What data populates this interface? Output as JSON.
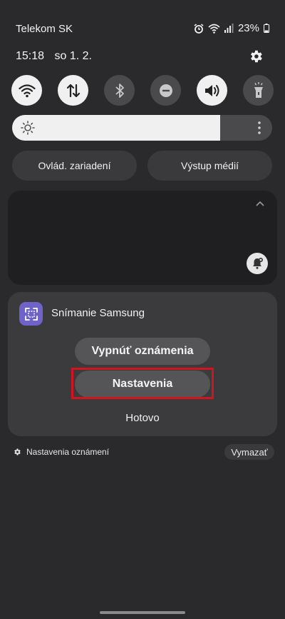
{
  "status": {
    "carrier": "Telekom SK",
    "battery": "23%"
  },
  "header": {
    "time": "15:18",
    "date": "so 1. 2."
  },
  "quick_settings": [
    {
      "icon": "wifi-icon",
      "state": "on"
    },
    {
      "icon": "mobile-data-icon",
      "state": "on"
    },
    {
      "icon": "bluetooth-icon",
      "state": "off"
    },
    {
      "icon": "do-not-disturb-icon",
      "state": "off"
    },
    {
      "icon": "sound-icon",
      "state": "on"
    },
    {
      "icon": "flashlight-icon",
      "state": "off"
    }
  ],
  "brightness": {
    "level": 0.8
  },
  "controls": {
    "device_control": "Ovlád. zariadení",
    "media_output": "Výstup médií"
  },
  "notification": {
    "app_name": "Snímanie Samsung",
    "actions": {
      "turn_off": "Vypnúť oznámenia",
      "settings": "Nastavenia",
      "done": "Hotovo"
    }
  },
  "footer": {
    "notification_settings": "Nastavenia oznámení",
    "clear": "Vymazať"
  }
}
